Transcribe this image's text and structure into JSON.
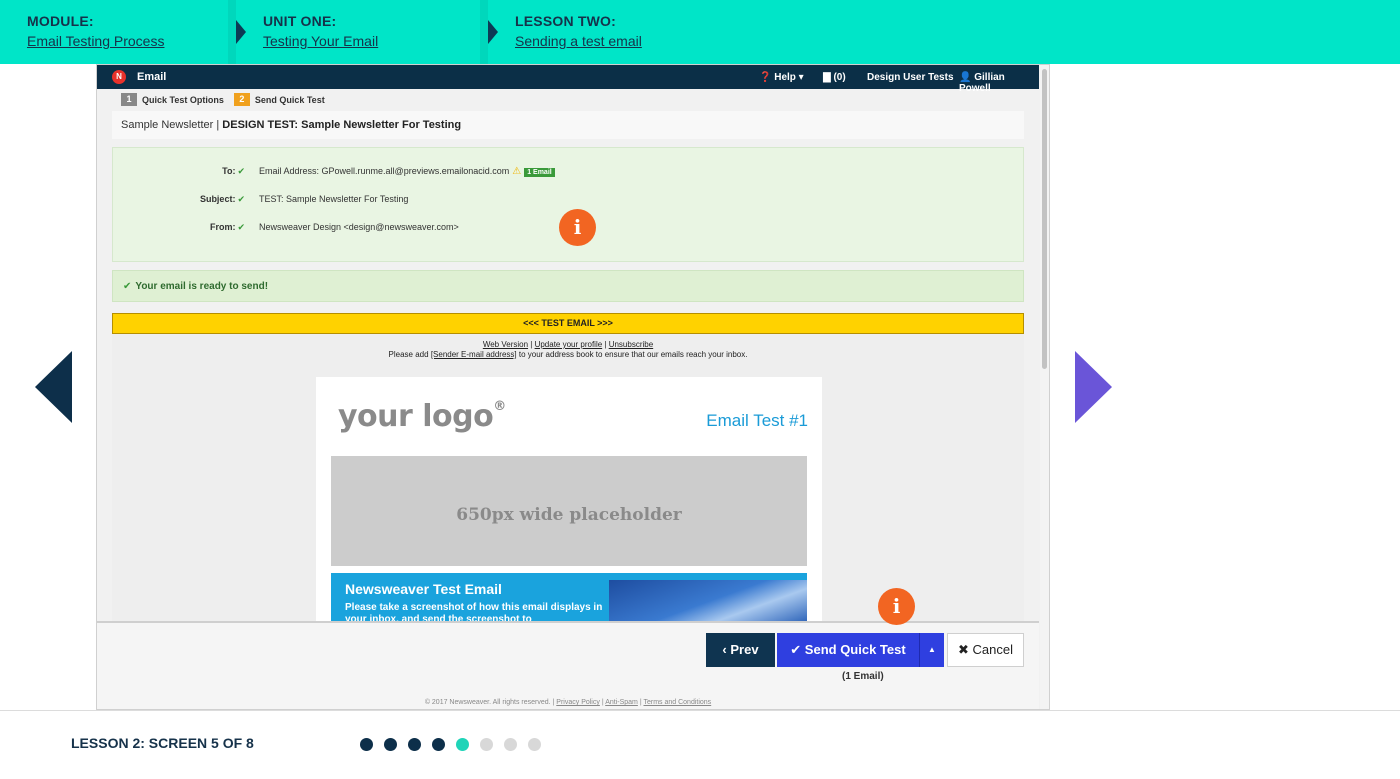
{
  "breadcrumbs": [
    {
      "label": "MODULE:",
      "link": "Email Testing Process"
    },
    {
      "label": "UNIT ONE:",
      "link": "Testing Your Email"
    },
    {
      "label": "LESSON TWO:",
      "link": "Sending a test email"
    }
  ],
  "app": {
    "logo_letter": "N",
    "title": "Email",
    "help": "❓ Help ▾",
    "notifications": "▇ (0)",
    "account": "Design User Tests",
    "user": "👤 Gillian Powell"
  },
  "steps": [
    {
      "num": "1",
      "label": "Quick Test Options"
    },
    {
      "num": "2",
      "label": "Send Quick Test"
    }
  ],
  "test_title": {
    "prefix": "Sample Newsletter | ",
    "name": "DESIGN TEST: Sample Newsletter For Testing"
  },
  "fields": {
    "to_label": "To:",
    "to_value": "Email Address: GPowell.runme.all@previews.emailonacid.com",
    "to_badge": "1 Email",
    "subject_label": "Subject:",
    "subject_value": "TEST: Sample Newsletter For Testing",
    "from_label": "From:",
    "from_value": "Newsweaver Design <design@newsweaver.com>"
  },
  "ready_message": "Your email is ready to send!",
  "preview": {
    "banner": "<<< TEST EMAIL >>>",
    "web_version": "Web Version",
    "update_profile": "Update your profile",
    "unsubscribe": "Unsubscribe",
    "add_prefix": "Please add ",
    "add_sender": "[Sender E-mail address]",
    "add_suffix": " to your address book to ensure that our emails reach your inbox.",
    "logo_text": "your logo",
    "logo_mark": "®",
    "email_heading": "Email Test #1",
    "placeholder": "650px wide placeholder",
    "block_title": "Newsweaver Test Email",
    "block_text": "Please take a screenshot of how this email displays in your inbox, and send the screenshot to"
  },
  "actions": {
    "prev": "‹ Prev",
    "send": "✔ Send Quick Test",
    "caret": "▲",
    "cancel": "✖ Cancel",
    "count": "(1 Email)"
  },
  "footer": {
    "copyright": "© 2017 Newsweaver. All rights reserved. | ",
    "privacy": "Privacy Policy",
    "antispam": "Anti-Spam",
    "terms": "Terms and Conditions"
  },
  "info_icon": "i",
  "lesson_screen": "LESSON 2: SCREEN 5 OF 8",
  "progress": {
    "total": 8,
    "current": 5
  },
  "colors": {
    "topbar": "#00e5c8",
    "accent_purple": "#6a55d8",
    "navy": "#0d2f4a",
    "info_orange": "#f26522"
  }
}
